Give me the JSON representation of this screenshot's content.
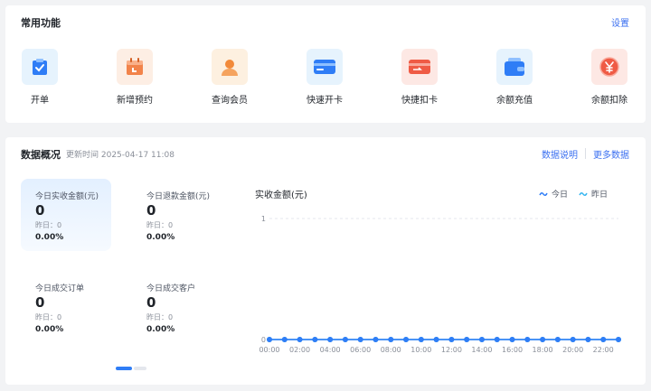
{
  "common": {
    "title": "常用功能",
    "settings_label": "设置",
    "features": [
      {
        "label": "开单",
        "icon": "order-clipboard-icon"
      },
      {
        "label": "新增预约",
        "icon": "calendar-icon"
      },
      {
        "label": "查询会员",
        "icon": "member-user-icon"
      },
      {
        "label": "快速开卡",
        "icon": "card-icon"
      },
      {
        "label": "快捷扣卡",
        "icon": "deduct-card-icon"
      },
      {
        "label": "余额充值",
        "icon": "wallet-icon"
      },
      {
        "label": "余额扣除",
        "icon": "yuan-coin-icon"
      }
    ]
  },
  "overview": {
    "title": "数据概况",
    "updated": "更新时间 2025-04-17 11:08",
    "explain_link": "数据说明",
    "more_link": "更多数据",
    "stats": [
      {
        "label": "今日实收金额(元)",
        "value": "0",
        "yesterday": "昨日：0",
        "pct": "0.00%"
      },
      {
        "label": "今日退款金额(元)",
        "value": "0",
        "yesterday": "昨日：0",
        "pct": "0.00%"
      },
      {
        "label": "今日成交订单",
        "value": "0",
        "yesterday": "昨日：0",
        "pct": "0.00%"
      },
      {
        "label": "今日成交客户",
        "value": "0",
        "yesterday": "昨日：0",
        "pct": "0.00%"
      }
    ]
  },
  "colors": {
    "accent": "#3a6ff0",
    "today_line": "#2f7df6",
    "yesterday_line": "#36b5f0"
  },
  "chart_data": {
    "type": "line",
    "title": "实收金额(元)",
    "x": [
      "00:00",
      "01:00",
      "02:00",
      "03:00",
      "04:00",
      "05:00",
      "06:00",
      "07:00",
      "08:00",
      "09:00",
      "10:00",
      "11:00",
      "12:00",
      "13:00",
      "14:00",
      "15:00",
      "16:00",
      "17:00",
      "18:00",
      "19:00",
      "20:00",
      "21:00",
      "22:00",
      "23:00"
    ],
    "x_tick_labels": [
      "00:00",
      "02:00",
      "04:00",
      "06:00",
      "08:00",
      "10:00",
      "12:00",
      "14:00",
      "16:00",
      "18:00",
      "20:00",
      "22:00"
    ],
    "y_tick_labels": [
      "0",
      "1"
    ],
    "ylim": [
      0,
      1
    ],
    "series": [
      {
        "name": "今日",
        "values": [
          0,
          0,
          0,
          0,
          0,
          0,
          0,
          0,
          0,
          0,
          0,
          0,
          0,
          0,
          0,
          0,
          0,
          0,
          0,
          0,
          0,
          0,
          0,
          0
        ]
      },
      {
        "name": "昨日",
        "values": [
          0,
          0,
          0,
          0,
          0,
          0,
          0,
          0,
          0,
          0,
          0,
          0,
          0,
          0,
          0,
          0,
          0,
          0,
          0,
          0,
          0,
          0,
          0,
          0
        ]
      }
    ],
    "legend": "top-right",
    "grid": true
  }
}
